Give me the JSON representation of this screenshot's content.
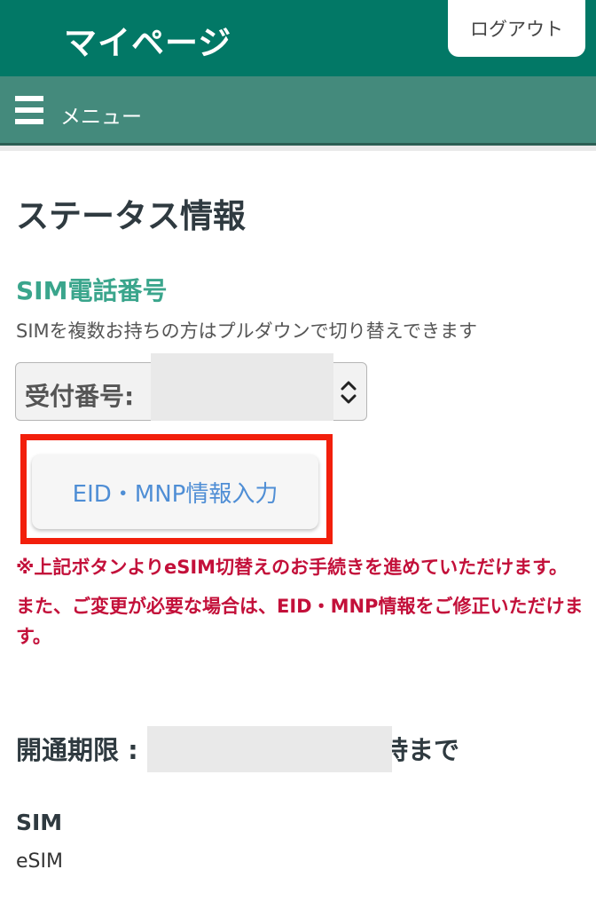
{
  "header": {
    "title": "マイページ",
    "logout_label": "ログアウト"
  },
  "menu": {
    "label": "メニュー",
    "icon": "hamburger-icon"
  },
  "main": {
    "title": "ステータス情報",
    "sim_number_heading": "SIM電話番号",
    "sim_number_help": "SIMを複数お持ちの方はプルダウンで切り替えできます",
    "sim_select_value": "受付番号:",
    "eid_mnp_button_label": "EID・MNP情報入力",
    "notice_lines": [
      "※上記ボタンよりeSIM切替えのお手続きを進めていただけます。",
      "また、ご変更が必要な場合は、EID・MNP情報をご修正いただけます。"
    ],
    "expiry_label": "開通期限 :",
    "expiry_suffix": "時まで",
    "sim_type_heading": "SIM",
    "sim_type_value": "eSIM"
  },
  "colors": {
    "header_bg": "#027866",
    "menu_bg": "#448a7c",
    "accent_green": "#3aa58c",
    "notice_red": "#c3103a",
    "button_text_blue": "#4f8ed5",
    "highlight_red": "#f21f0c"
  }
}
